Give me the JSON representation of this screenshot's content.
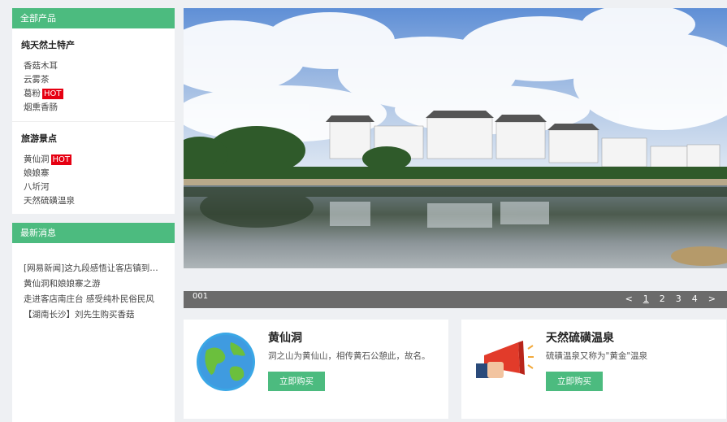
{
  "sidebar": {
    "products": {
      "header": "全部产品",
      "categories": [
        {
          "title": "纯天然土特产",
          "items": [
            {
              "label": "香菇木耳",
              "hot": ""
            },
            {
              "label": "云雾茶",
              "hot": ""
            },
            {
              "label": "葛粉",
              "hot": "HOT"
            },
            {
              "label": "烟熏香肠",
              "hot": ""
            }
          ]
        },
        {
          "title": "旅游景点",
          "items": [
            {
              "label": "黄仙洞",
              "hot": "HOT"
            },
            {
              "label": "娘娘寨",
              "hot": ""
            },
            {
              "label": "八圻河",
              "hot": ""
            },
            {
              "label": "天然硫磺温泉",
              "hot": ""
            }
          ]
        }
      ]
    },
    "news": {
      "header": "最新消息",
      "items": [
        "[网易新闻]这九段感悟让客店镇到…",
        "黄仙洞和娘娘寨之游",
        "走进客店南庄台 感受纯朴民俗民风",
        "【湖南长沙】刘先生购买香菇"
      ]
    }
  },
  "banner": {
    "slide_id": "001"
  },
  "pager": {
    "prev": "<",
    "pages": [
      "1",
      "2",
      "3",
      "4"
    ],
    "active_page": "1",
    "next": ">"
  },
  "cards": [
    {
      "title": "黄仙洞",
      "desc": "洞之山为黄仙山，相传黄石公憩此，故名。",
      "button": "立即购买",
      "icon": "globe-icon"
    },
    {
      "title": "天然硫磺温泉",
      "desc": "硫磺温泉又称为\"黄金\"温泉",
      "button": "立即购买",
      "icon": "megaphone-icon"
    }
  ],
  "colors": {
    "accent": "#4cbb7f",
    "hot": "#e60012",
    "pager_bg": "#6b6b6b"
  }
}
